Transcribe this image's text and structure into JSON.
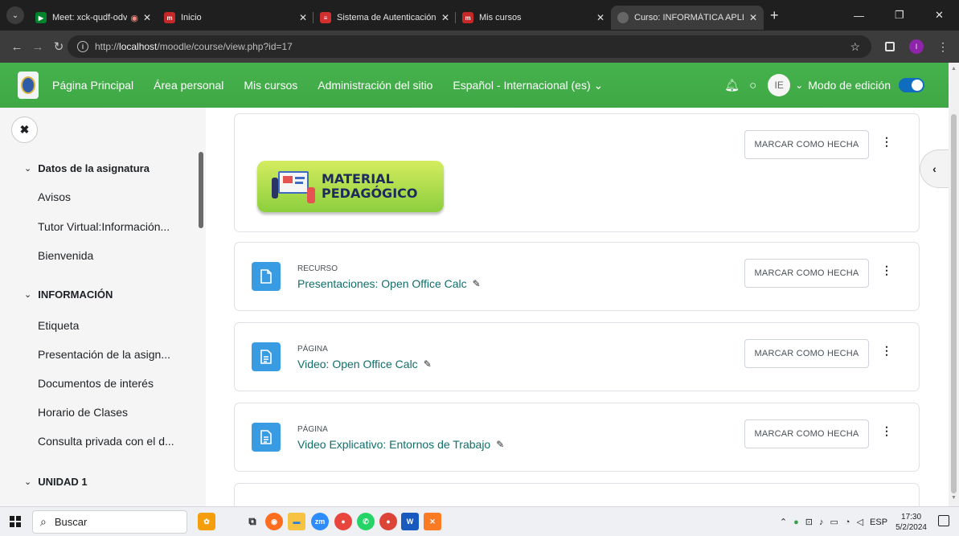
{
  "browser": {
    "tabs": [
      {
        "title": "Meet: xck-qudf-odv",
        "active": false,
        "recording": true
      },
      {
        "title": "Inicio",
        "active": false
      },
      {
        "title": "Sistema de Autenticación Ce",
        "active": false
      },
      {
        "title": "Mis cursos",
        "active": false
      },
      {
        "title": "Curso: INFORMÁTICA APLIC",
        "active": true
      }
    ],
    "url_prefix": "http://",
    "url_host": "localhost",
    "url_path": "/moodle/course/view.php?id=17",
    "profile_initial": "I"
  },
  "navbar": {
    "links": [
      "Página Principal",
      "Área personal",
      "Mis cursos",
      "Administración del sitio",
      "Español - Internacional (es)"
    ],
    "avatar_initials": "IE",
    "edit_mode_label": "Modo de edición",
    "edit_mode_on": true
  },
  "drawer": {
    "sections": [
      {
        "title": "Datos de la asignatura",
        "items": [
          "Avisos",
          "Tutor Virtual:Información...",
          "Bienvenida"
        ]
      },
      {
        "title": "INFORMACIÓN",
        "items": [
          "Etiqueta",
          "Presentación de la asign...",
          "Documentos de interés",
          "Horario de Clases",
          "Consulta privada con el d..."
        ]
      },
      {
        "title": "UNIDAD 1",
        "items": []
      }
    ]
  },
  "course": {
    "banner_line1": "MATERIAL",
    "banner_line2": "PEDAGÓGICO",
    "mark_label": "MARCAR COMO HECHA",
    "activities": [
      {
        "type": "RECURSO",
        "name": "Presentaciones: Open Office Calc",
        "icon": "file-icon"
      },
      {
        "type": "PÁGINA",
        "name": "Video: Open Office Calc",
        "icon": "page-icon"
      },
      {
        "type": "PÁGINA",
        "name": "Video Explicativo: Entornos de Trabajo",
        "icon": "page-icon"
      }
    ]
  },
  "taskbar": {
    "search_placeholder": "Buscar",
    "language": "ESP",
    "time": "17:30",
    "date": "5/2/2024"
  },
  "colors": {
    "navbar": "#45b24d",
    "activity_icon": "#399be2",
    "activity_link": "#0f6f6a",
    "toggle": "#0f6cbf"
  }
}
